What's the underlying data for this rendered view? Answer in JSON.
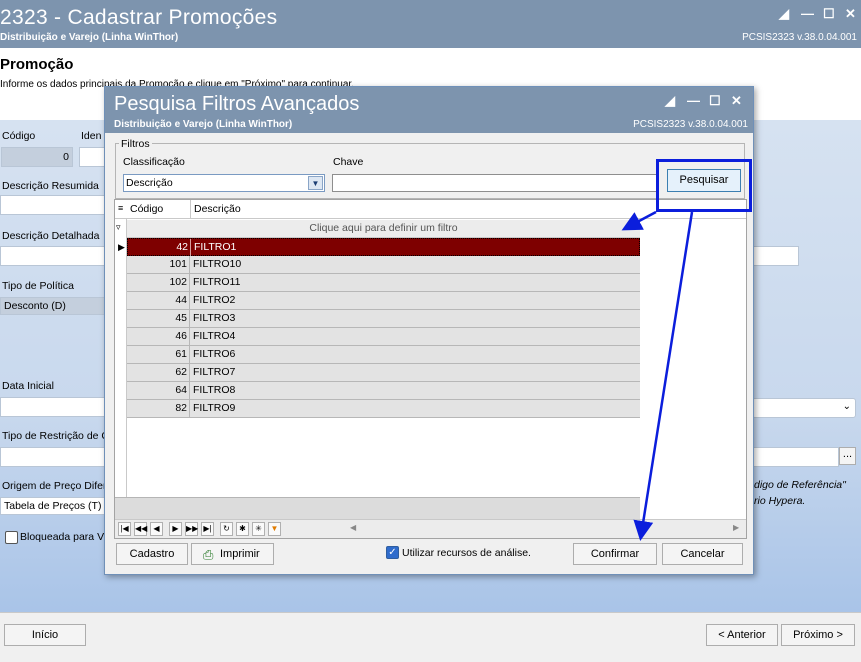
{
  "main_window": {
    "title": "2323 - Cadastrar Promoções",
    "subtitle": "Distribuição e Varejo (Linha WinThor)",
    "version": "PCSIS2323  v.38.0.04.001",
    "section_title": "Promoção",
    "section_subtitle": "Informe os dados principais da Promoção e clique em \"Próximo\" para continuar.",
    "codigo_label": "Código",
    "codigo_value": "0",
    "ident_label": "Iden",
    "descricao_resumida_label": "Descrição Resumida",
    "descricao_detalhada_label": "Descrição Detalhada",
    "tipo_politica_label": "Tipo de Política",
    "tipo_politica_value": "Desconto (D)",
    "data_inicial_label": "Data Inicial",
    "tipo_restricao_label": "Tipo de Restrição de C",
    "origem_preco_label": "Origem de Preço Difer",
    "origem_preco_value": "Tabela de Preços (T)",
    "bloqueada_label": "Bloqueada para V",
    "right_note_1": "digo de Referência\"",
    "right_note_2": "rio Hypera.",
    "ellipsis": "...",
    "inicio_button": "Início",
    "anterior_button": "< Anterior",
    "proximo_button": "Próximo >"
  },
  "dialog": {
    "title": "Pesquisa Filtros Avançados",
    "subtitle": "Distribuição e Varejo (Linha WinThor)",
    "version": "PCSIS2323  v.38.0.04.001",
    "filtros_legend": "Filtros",
    "classificacao_label": "Classificação",
    "classificacao_value": "Descrição",
    "chave_label": "Chave",
    "chave_value": "",
    "pesquisar_button": "Pesquisar",
    "grid": {
      "columns": [
        "Código",
        "Descrição"
      ],
      "filter_hint": "Clique aqui para definir um filtro",
      "rows": [
        {
          "codigo": "42",
          "descricao": "FILTRO1",
          "selected": true
        },
        {
          "codigo": "101",
          "descricao": "FILTRO10"
        },
        {
          "codigo": "102",
          "descricao": "FILTRO11"
        },
        {
          "codigo": "44",
          "descricao": "FILTRO2"
        },
        {
          "codigo": "45",
          "descricao": "FILTRO3"
        },
        {
          "codigo": "46",
          "descricao": "FILTRO4"
        },
        {
          "codigo": "61",
          "descricao": "FILTRO6"
        },
        {
          "codigo": "62",
          "descricao": "FILTRO7"
        },
        {
          "codigo": "64",
          "descricao": "FILTRO8"
        },
        {
          "codigo": "82",
          "descricao": "FILTRO9"
        }
      ]
    },
    "cadastro_button": "Cadastro",
    "imprimir_button": "Imprimir",
    "utilizar_label": "Utilizar recursos de análise.",
    "utilizar_checked": true,
    "confirmar_button": "Confirmar",
    "cancelar_button": "Cancelar"
  },
  "colors": {
    "titlebar": "#7d94ae",
    "selected_row": "#7e0000",
    "annotation": "#0b1edc"
  }
}
